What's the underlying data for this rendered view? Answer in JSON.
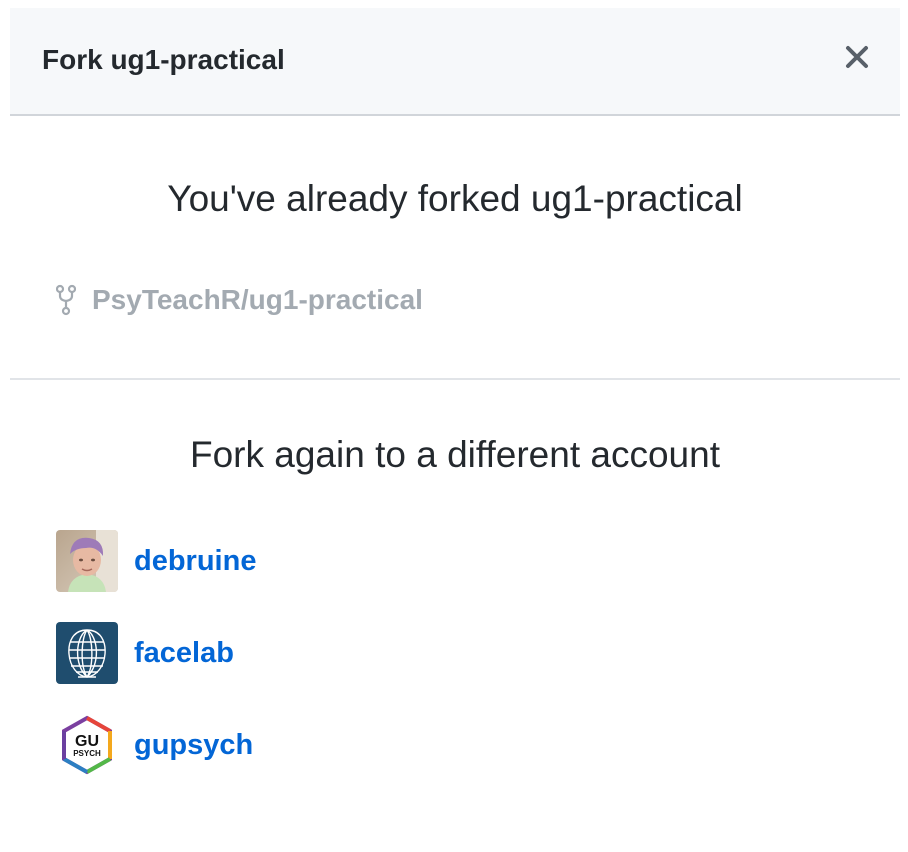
{
  "dialog": {
    "title": "Fork ug1-practical",
    "close_icon": "close-icon"
  },
  "forked": {
    "heading": "You've already forked ug1-practical",
    "repo_icon": "repo-forked-icon",
    "repo_name": "PsyTeachR/ug1-practical"
  },
  "fork_again": {
    "heading": "Fork again to a different account",
    "accounts": [
      {
        "name": "debruine",
        "avatar": "user-photo-avatar"
      },
      {
        "name": "facelab",
        "avatar": "face-mesh-avatar"
      },
      {
        "name": "gupsych",
        "avatar": "gu-psych-hexagon-logo"
      }
    ]
  },
  "colors": {
    "link": "#0366d6",
    "muted": "#a3aab1",
    "header_bg": "#f6f8fa",
    "facelab_bg": "#1f4d6e"
  }
}
